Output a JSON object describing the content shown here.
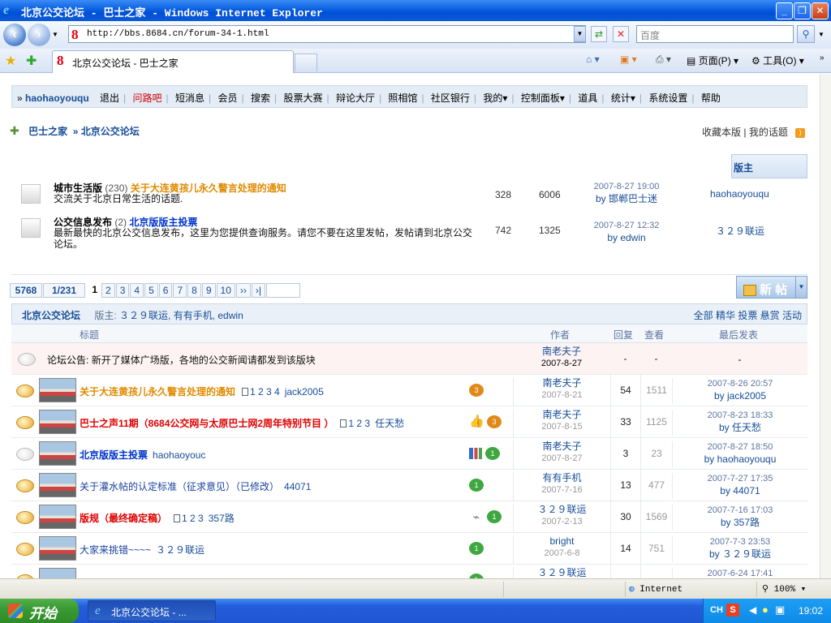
{
  "window": {
    "title": "北京公交论坛 - 巴士之家 - Windows Internet Explorer"
  },
  "address": {
    "url": "http://bbs.8684.cn/forum-34-1.html",
    "search_placeholder": "百度"
  },
  "tab": {
    "label": "北京公交论坛 - 巴士之家"
  },
  "toolbar": {
    "page_label": "页面(P)",
    "tools_label": "工具(O)"
  },
  "menubar": {
    "user": "haohaoyouqu",
    "items": [
      "退出",
      "问路吧",
      "短消息",
      "会员",
      "搜索",
      "股票大赛",
      "辩论大厅",
      "照相馆",
      "社区银行",
      "我的▾",
      "控制面板▾",
      "道具",
      "统计▾",
      "系统设置",
      "帮助"
    ]
  },
  "breadcrumb": {
    "home": "巴士之家",
    "current": "北京公交论坛",
    "right_links": [
      "收藏本版",
      "我的话题"
    ]
  },
  "subforums": {
    "mod_header": "版主",
    "items": [
      {
        "name": "城市生活版",
        "count": "(230)",
        "hot_title": "关于大连黄孩儿永久警言处理的通知",
        "desc": "交流关于北京日常生活的话题.",
        "topics": "328",
        "posts": "6006",
        "last_date": "2007-8-27 19:00",
        "last_by": "by 邯郸巴士迷",
        "mods": "haohaoyouqu"
      },
      {
        "name": "公交信息发布",
        "count": "(2)",
        "hot_title": "北京版版主投票",
        "desc": "最新最快的北京公交信息发布，这里为您提供查询服务。请您不要在这里发帖，发帖请到北京公交论坛。",
        "topics": "742",
        "posts": "1325",
        "last_date": "2007-8-27 12:32",
        "last_by": "by edwin",
        "mods": "３２９联运"
      }
    ]
  },
  "pager": {
    "total": "5768",
    "pos": "1/231",
    "current": "1",
    "pages": [
      "2",
      "3",
      "4",
      "5",
      "6",
      "7",
      "8",
      "9",
      "10"
    ],
    "next": "››",
    "last": "›|"
  },
  "new_button": {
    "label": "新 帖"
  },
  "list": {
    "forum_name": "北京公交论坛",
    "mods_label": "版主:",
    "mods": "３２９联运, 有有手机, edwin",
    "filters": "全部  精华  投票  悬赏  活动",
    "cols": {
      "title": "标题",
      "author": "作者",
      "replies": "回复",
      "views": "查看",
      "last": "最后发表"
    }
  },
  "announcement": {
    "label": "论坛公告:",
    "text": "新开了媒体广场版，各地的公交新闻请都发到该版块",
    "author": "南老夫子",
    "date": "2007-8-27",
    "replies": "-",
    "views": "-",
    "last": "-"
  },
  "threads": [
    {
      "title": "关于大连黄孩儿永久警言处理的通知",
      "style": "orange",
      "pages": "1 2 3 4",
      "last_user": "jack2005",
      "flags": [
        "o"
      ],
      "author": "南老夫子",
      "date": "2007-8-21",
      "replies": "54",
      "views": "1511",
      "last_date": "2007-8-26 20:57",
      "last_by": "by jack2005"
    },
    {
      "title": "巴士之声11期（8684公交网与太原巴士网2周年特别节目 ）",
      "style": "red",
      "pages": "1 2 3",
      "last_user": "任天愁",
      "flags": [
        "thumb",
        "o"
      ],
      "author": "南老夫子",
      "date": "2007-8-15",
      "replies": "33",
      "views": "1125",
      "last_date": "2007-8-23 18:33",
      "last_by": "by 任天愁"
    },
    {
      "title": "北京版版主投票",
      "style": "blue",
      "pages": "",
      "last_user": "haohaoyouc",
      "flags": [
        "chart",
        "g"
      ],
      "author": "南老夫子",
      "date": "2007-8-27",
      "replies": "3",
      "views": "23",
      "last_date": "2007-8-27 18:50",
      "last_by": "by haohaoyouqu"
    },
    {
      "title": "关于灌水帖的认定标准（征求意见）（已修改）",
      "style": "plain",
      "pages": "",
      "last_user": "44071",
      "flags": [
        "g"
      ],
      "author": "有有手机",
      "date": "2007-7-16",
      "replies": "13",
      "views": "477",
      "last_date": "2007-7-27 17:35",
      "last_by": "by 44071"
    },
    {
      "title": "版规（最终确定稿）",
      "style": "red",
      "pages": "1 2 3",
      "last_user": "357路",
      "flags": [
        "clip",
        "g"
      ],
      "author": "３２９联运",
      "date": "2007-2-13",
      "replies": "30",
      "views": "1569",
      "last_date": "2007-7-16 17:03",
      "last_by": "by 357路"
    },
    {
      "title": "大家来挑错~~~~",
      "style": "plain",
      "pages": "",
      "last_user": "３２９联运",
      "flags": [
        "g"
      ],
      "author": "bright",
      "date": "2007-6-8",
      "replies": "14",
      "views": "751",
      "last_date": "2007-7-3 23:53",
      "last_by": "by ３２９联运"
    },
    {
      "title": "",
      "style": "plain",
      "pages": "",
      "last_user": "",
      "flags": [
        "g"
      ],
      "author": "３２９联运",
      "date": "",
      "replies": "",
      "views": "",
      "last_date": "2007-6-24 17:41",
      "last_by": ""
    }
  ],
  "status": {
    "zone": "Internet",
    "zoom": "100%"
  },
  "taskbar": {
    "start": "开始",
    "task": "北京公交论坛 - ...",
    "ime": "CH",
    "clock": "19:02"
  }
}
